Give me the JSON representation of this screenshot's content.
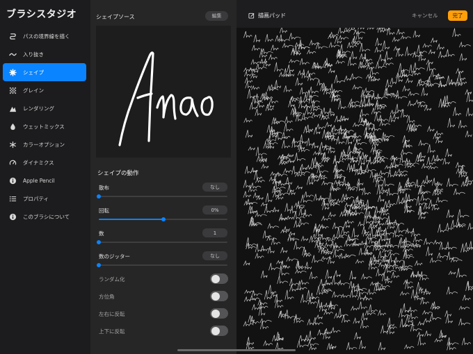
{
  "app": {
    "title": "ブラシスタジオ"
  },
  "sidebar": {
    "items": [
      {
        "label": "パスの境界線を描く",
        "icon": "stroke-path-icon",
        "active": false
      },
      {
        "label": "入り抜き",
        "icon": "taper-icon",
        "active": false
      },
      {
        "label": "シェイプ",
        "icon": "shape-gear-icon",
        "active": true
      },
      {
        "label": "グレイン",
        "icon": "grain-icon",
        "active": false
      },
      {
        "label": "レンダリング",
        "icon": "rendering-icon",
        "active": false
      },
      {
        "label": "ウェットミックス",
        "icon": "wet-mix-drop-icon",
        "active": false
      },
      {
        "label": "カラーオプション",
        "icon": "color-options-icon",
        "active": false
      },
      {
        "label": "ダイナミクス",
        "icon": "dynamics-icon",
        "active": false
      },
      {
        "label": "Apple Pencil",
        "icon": "apple-pencil-icon",
        "active": false
      },
      {
        "label": "プロパティ",
        "icon": "properties-list-icon",
        "active": false
      },
      {
        "label": "このブラシについて",
        "icon": "info-icon",
        "active": false
      }
    ]
  },
  "panel": {
    "shape_source_title": "シェイプソース",
    "edit_label": "編集",
    "preview_text": "Anao",
    "behavior_title": "シェイプの動作",
    "sliders": [
      {
        "label": "散布",
        "value": "なし",
        "level": 0.0
      },
      {
        "label": "回転",
        "value": "0%",
        "level": 0.5
      },
      {
        "label": "数",
        "value": "1",
        "level": 0.0
      },
      {
        "label": "数のジッター",
        "value": "なし",
        "level": 0.0
      }
    ],
    "toggles": [
      {
        "label": "ランダム化",
        "on": false
      },
      {
        "label": "方位角",
        "on": false
      },
      {
        "label": "左右に反転",
        "on": false
      },
      {
        "label": "上下に反転",
        "on": false
      }
    ]
  },
  "pad": {
    "title": "描画パッド",
    "title_icon": "edit-pencil-icon",
    "cancel_label": "キャンセル",
    "done_label": "完了"
  },
  "colors": {
    "accent": "#0a84ff",
    "done": "#ff9f0a",
    "sidebar_bg": "#1c1c1e",
    "panel_bg": "#262626",
    "pad_bg": "#121212"
  }
}
